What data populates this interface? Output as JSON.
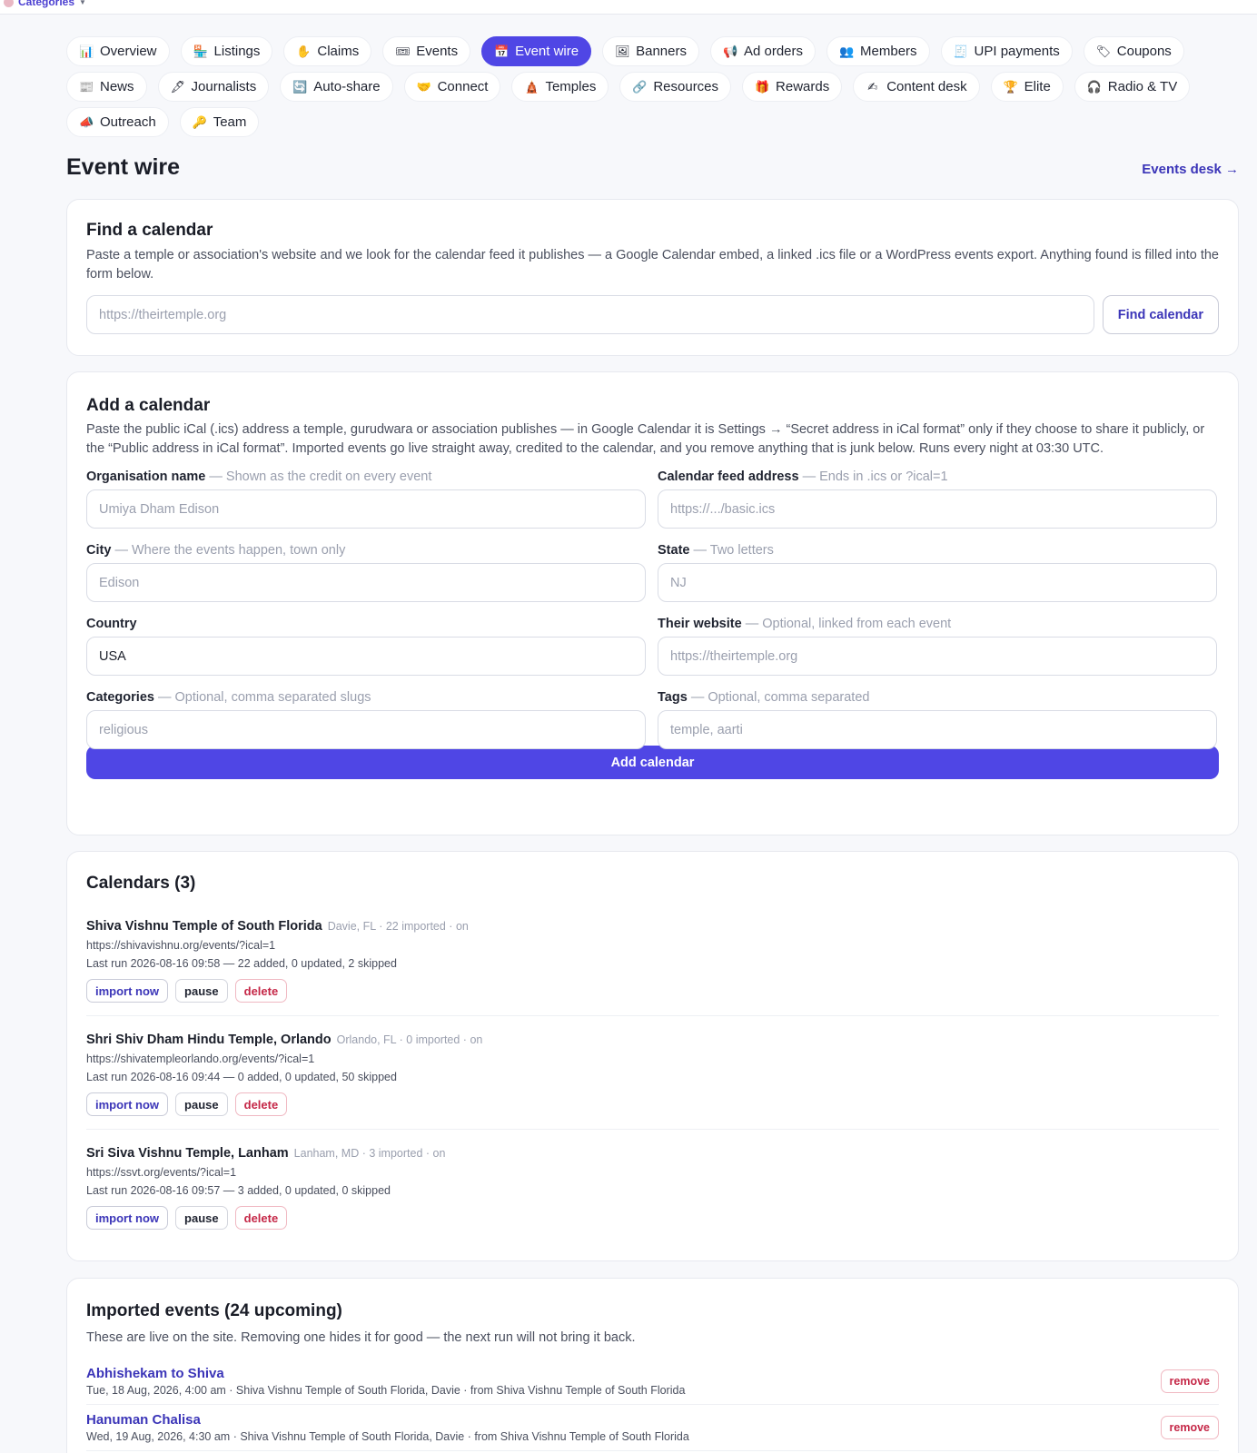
{
  "topbar": {
    "categories_label": "Categories"
  },
  "nav": {
    "tabs": [
      {
        "label": "Overview",
        "icon": "📊"
      },
      {
        "label": "Listings",
        "icon": "🏪"
      },
      {
        "label": "Claims",
        "icon": "✋"
      },
      {
        "label": "Events",
        "icon": "🎟"
      },
      {
        "label": "Event wire",
        "icon": "📅"
      },
      {
        "label": "Banners",
        "icon": "🖼"
      },
      {
        "label": "Ad orders",
        "icon": "📢"
      },
      {
        "label": "Members",
        "icon": "👥"
      },
      {
        "label": "UPI payments",
        "icon": "🧾"
      },
      {
        "label": "Coupons",
        "icon": "🏷"
      },
      {
        "label": "News",
        "icon": "📰"
      },
      {
        "label": "Journalists",
        "icon": "🖋"
      },
      {
        "label": "Auto-share",
        "icon": "🔄"
      },
      {
        "label": "Connect",
        "icon": "🤝"
      },
      {
        "label": "Temples",
        "icon": "🛕"
      },
      {
        "label": "Resources",
        "icon": "🔗"
      },
      {
        "label": "Rewards",
        "icon": "🎁"
      },
      {
        "label": "Content desk",
        "icon": "✍"
      },
      {
        "label": "Elite",
        "icon": "🏆"
      },
      {
        "label": "Radio & TV",
        "icon": "🎧"
      },
      {
        "label": "Outreach",
        "icon": "📣"
      },
      {
        "label": "Team",
        "icon": "🔑"
      }
    ]
  },
  "header": {
    "title": "Event wire",
    "events_desk_link": "Events desk →"
  },
  "find_calendar": {
    "title": "Find a calendar",
    "description": "Paste a temple or association's website and we look for the calendar feed it publishes — a Google Calendar embed, a linked .ics file or a WordPress events export. Anything found is filled into the form below.",
    "input_placeholder": "https://theirtemple.org",
    "button_label": "Find calendar"
  },
  "add_calendar": {
    "title": "Add a calendar",
    "description": "Paste the public iCal (.ics) address a temple, gurudwara or association publishes — in Google Calendar it is Settings → “Secret address in iCal format” only if they choose to share it publicly, or the “Public address in iCal format”. Imported events go live straight away, credited to the calendar, and you remove anything that is junk below. Runs every night at 03:30 UTC.",
    "fields": {
      "org_name": {
        "label": "Organisation name",
        "hint": "— Shown as the credit on every event",
        "placeholder": "Umiya Dham Edison"
      },
      "feed": {
        "label": "Calendar feed address",
        "hint": "— Ends in .ics or ?ical=1",
        "placeholder": "https://.../basic.ics"
      },
      "city": {
        "label": "City",
        "hint": "— Where the events happen, town only",
        "placeholder": "Edison"
      },
      "state": {
        "label": "State",
        "hint": "— Two letters",
        "placeholder": "NJ"
      },
      "country": {
        "label": "Country",
        "value": "USA"
      },
      "website": {
        "label": "Their website",
        "hint": "— Optional, linked from each event",
        "placeholder": "https://theirtemple.org"
      },
      "categories": {
        "label": "Categories",
        "hint": "— Optional, comma separated slugs",
        "placeholder": "religious"
      },
      "tags": {
        "label": "Tags",
        "hint": "— Optional, comma separated",
        "placeholder": "temple, aarti"
      }
    },
    "submit_label": "Add calendar"
  },
  "calendars": {
    "title": "Calendars (3)",
    "import_label": "import now",
    "pause_label": "pause",
    "delete_label": "delete",
    "items": [
      {
        "name": "Shiva Vishnu Temple of South Florida",
        "meta": "Davie, FL · 22 imported · on",
        "url": "https://shivavishnu.org/events/?ical=1",
        "last_run": "Last run 2026-08-16 09:58 — 22 added, 0 updated, 2 skipped"
      },
      {
        "name": "Shri Shiv Dham Hindu Temple, Orlando",
        "meta": "Orlando, FL · 0 imported · on",
        "url": "https://shivatempleorlando.org/events/?ical=1",
        "last_run": "Last run 2026-08-16 09:44 — 0 added, 0 updated, 50 skipped"
      },
      {
        "name": "Sri Siva Vishnu Temple, Lanham",
        "meta": "Lanham, MD · 3 imported · on",
        "url": "https://ssvt.org/events/?ical=1",
        "last_run": "Last run 2026-08-16 09:57 — 3 added, 0 updated, 0 skipped"
      }
    ]
  },
  "imported": {
    "title": "Imported events (24 upcoming)",
    "description": "These are live on the site. Removing one hides it for good — the next run will not bring it back.",
    "remove_label": "remove",
    "items": [
      {
        "title": "Abhishekam to Shiva",
        "sub": "Tue, 18 Aug, 2026, 4:00 am · Shiva Vishnu Temple of South Florida, Davie · from Shiva Vishnu Temple of South Florida"
      },
      {
        "title": "Hanuman Chalisa",
        "sub": "Wed, 19 Aug, 2026, 4:30 am · Shiva Vishnu Temple of South Florida, Davie · from Shiva Vishnu Temple of South Florida"
      }
    ]
  }
}
